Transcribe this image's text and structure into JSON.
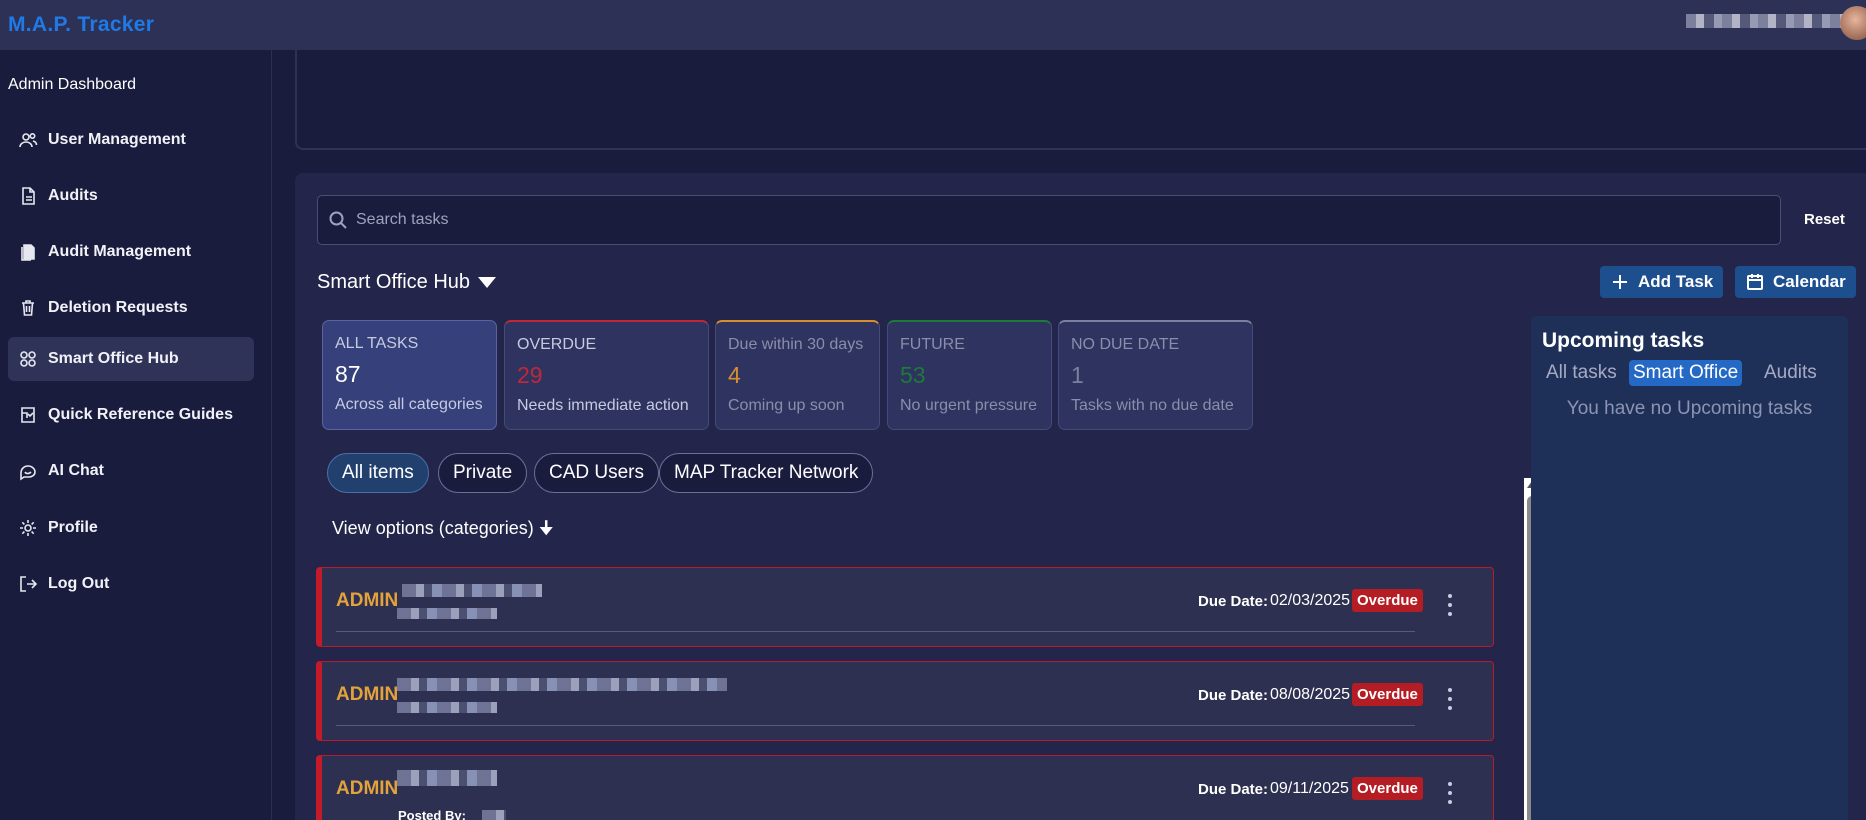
{
  "app": {
    "title": "M.A.P. Tracker"
  },
  "sidebar": {
    "header": "Admin Dashboard",
    "items": [
      {
        "label": "User Management",
        "icon": "users-icon"
      },
      {
        "label": "Audits",
        "icon": "document-icon"
      },
      {
        "label": "Audit Management",
        "icon": "clipboard-icon"
      },
      {
        "label": "Deletion Requests",
        "icon": "trash-icon"
      },
      {
        "label": "Smart Office Hub",
        "icon": "grid-icon",
        "active": true
      },
      {
        "label": "Quick Reference Guides",
        "icon": "book-icon"
      },
      {
        "label": "AI Chat",
        "icon": "chat-icon"
      },
      {
        "label": "Profile",
        "icon": "gear-icon"
      },
      {
        "label": "Log Out",
        "icon": "logout-icon"
      }
    ]
  },
  "search": {
    "placeholder": "Search tasks",
    "value": "",
    "reset_label": "Reset"
  },
  "hub": {
    "title": "Smart Office Hub",
    "add_task_label": "Add Task",
    "calendar_label": "Calendar"
  },
  "stats": [
    {
      "label": "ALL TASKS",
      "value": "87",
      "desc": "Across all categories",
      "color": "#ffffff",
      "accent": ""
    },
    {
      "label": "OVERDUE",
      "value": "29",
      "desc": "Needs immediate action",
      "color": "#c0283a",
      "accent": "#c0283a"
    },
    {
      "label": "Due within 30 days",
      "value": "4",
      "desc": "Coming up soon",
      "color": "#d78f2e",
      "accent": "#d78f2e"
    },
    {
      "label": "FUTURE",
      "value": "53",
      "desc": "No urgent pressure",
      "color": "#1d7a3a",
      "accent": "#1d7a3a"
    },
    {
      "label": "NO DUE DATE",
      "value": "1",
      "desc": "Tasks with no due date",
      "color": "#7c80a0",
      "accent": "#7c80a0"
    }
  ],
  "filters": [
    "All items",
    "Private",
    "CAD Users",
    "MAP Tracker Network"
  ],
  "view_options_label": "View options (categories) 🠋",
  "tasks": [
    {
      "tag": "ADMIN",
      "due_label": "Due Date:",
      "due_date": "02/03/2025",
      "status": "Overdue"
    },
    {
      "tag": "ADMIN",
      "due_label": "Due Date:",
      "due_date": "08/08/2025",
      "status": "Overdue"
    },
    {
      "tag": "ADMIN",
      "due_label": "Due Date:",
      "due_date": "09/11/2025",
      "status": "Overdue",
      "posted_by": "Posted By:"
    }
  ],
  "upcoming": {
    "title": "Upcoming tasks",
    "tabs": [
      "All tasks",
      "Smart Office",
      "Audits"
    ],
    "empty_text": "You have no Upcoming tasks"
  }
}
